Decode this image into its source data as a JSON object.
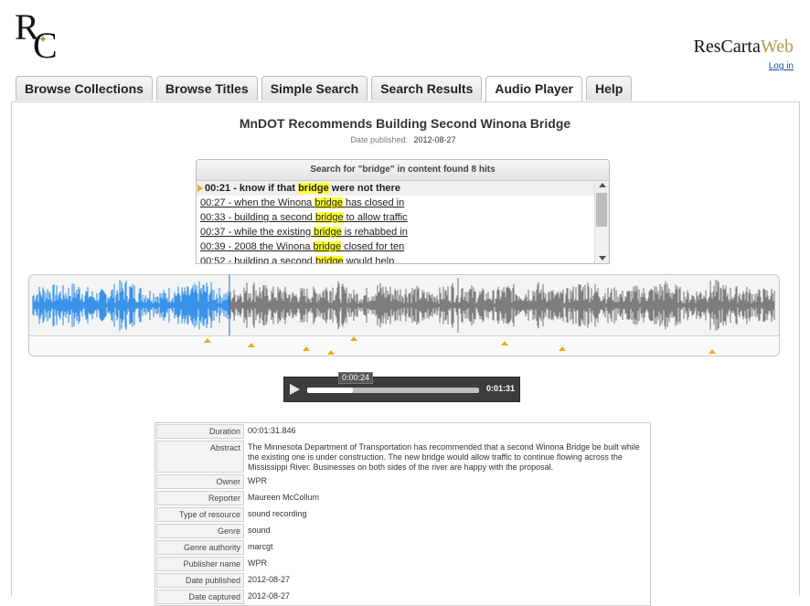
{
  "header": {
    "logo_r": "R",
    "logo_c": "C",
    "logo_star": "✦",
    "brand_prefix": "ResCarta",
    "brand_suffix": "Web",
    "login": "Log in"
  },
  "tabs": [
    "Browse Collections",
    "Browse Titles",
    "Simple Search",
    "Search Results",
    "Audio Player",
    "Help"
  ],
  "active_tab": "Audio Player",
  "doc": {
    "title": "MnDOT Recommends Building Second Winona Bridge",
    "pub_label": "Date published:",
    "pub_value": "2012-08-27"
  },
  "hits": {
    "header": "Search for \"bridge\" in content found 8 hits",
    "items": [
      {
        "pre": "00:21 - know if that ",
        "hl": "bridge",
        "post": " were not there"
      },
      {
        "pre": "00:27 - when the Winona ",
        "hl": "bridge",
        "post": " has closed in"
      },
      {
        "pre": "00:33 - building a second ",
        "hl": "bridge",
        "post": " to allow traffic"
      },
      {
        "pre": "00:37 - while the existing ",
        "hl": "bridge",
        "post": " is rehabbed in"
      },
      {
        "pre": "00:39 - 2008 the Winona ",
        "hl": "bridge",
        "post": " closed for ten"
      },
      {
        "pre": "00:52 - building a second ",
        "hl": "bridge",
        "post": " would help"
      }
    ]
  },
  "waveform": {
    "played_fraction": 0.265,
    "played_color": "#3a93e8",
    "unplayed_color": "#7d7d7d",
    "marker_color": "#f0a81d",
    "marker_fractions": [
      0.238,
      0.296,
      0.369,
      0.403,
      0.433,
      0.634,
      0.711,
      0.911
    ]
  },
  "player": {
    "current_time": "0:00:24",
    "duration": "0:01:31",
    "progress": 0.265
  },
  "metadata": [
    {
      "key": "Duration",
      "value": "00:01:31.846"
    },
    {
      "key": "Abstract",
      "value": "The Minnesota Department of Transportation has recommended that a second Winona Bridge be built while the existing one is under construction. The new bridge would allow traffic to continue flowing across the Mississippi River. Businesses on both sides of the river are happy with the proposal."
    },
    {
      "key": "Owner",
      "value": "WPR"
    },
    {
      "key": "Reporter",
      "value": "Maureen McCollum"
    },
    {
      "key": "Type of resource",
      "value": "sound recording"
    },
    {
      "key": "Genre",
      "value": "sound"
    },
    {
      "key": "Genre authority",
      "value": "marcgt"
    },
    {
      "key": "Publisher name",
      "value": "WPR"
    },
    {
      "key": "Date published",
      "value": "2012-08-27"
    },
    {
      "key": "Date captured",
      "value": "2012-08-27"
    }
  ]
}
